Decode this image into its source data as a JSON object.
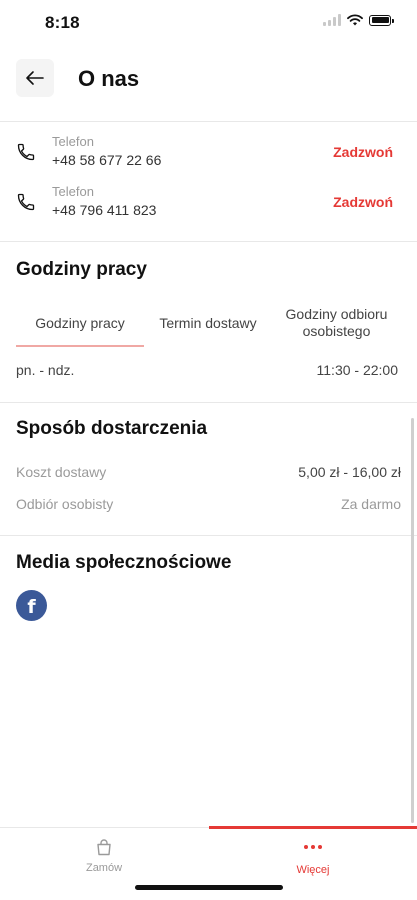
{
  "status_bar": {
    "time": "8:18"
  },
  "header": {
    "title": "O nas"
  },
  "contacts": [
    {
      "label": "Telefon",
      "number": "+48 58 677 22 66",
      "action": "Zadzwoń"
    },
    {
      "label": "Telefon",
      "number": "+48 796 411 823",
      "action": "Zadzwoń"
    }
  ],
  "hours": {
    "title": "Godziny pracy",
    "tabs": [
      "Godziny pracy",
      "Termin dostawy",
      "Godziny odbioru osobistego"
    ],
    "rows": [
      {
        "days": "pn. - ndz.",
        "time": "11:30 - 22:00"
      }
    ]
  },
  "delivery": {
    "title": "Sposób dostarczenia",
    "rows": [
      {
        "label": "Koszt dostawy",
        "value": "5,00 zł - 16,00 zł"
      },
      {
        "label": "Odbiór osobisty",
        "value": "Za darmo"
      }
    ]
  },
  "social": {
    "title": "Media społecznościowe",
    "icons": [
      "facebook-icon"
    ]
  },
  "bottom_nav": {
    "items": [
      {
        "label": "Zamów",
        "icon": "bag-icon",
        "active": false
      },
      {
        "label": "Więcej",
        "icon": "more-dots-icon",
        "active": true
      }
    ]
  },
  "colors": {
    "accent": "#e53935",
    "facebook": "#3b5998",
    "muted_text": "#9a9a9a"
  }
}
